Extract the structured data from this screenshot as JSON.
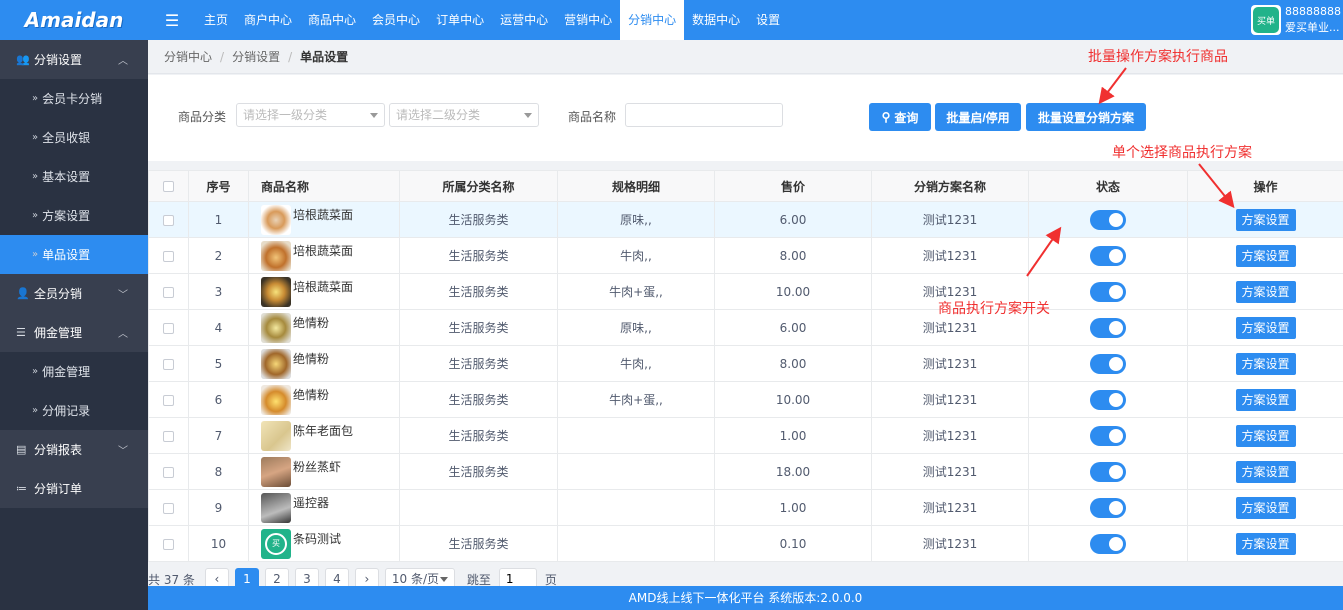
{
  "app": {
    "logo_text": "Amaidan",
    "menu_icon": "hamburger-icon"
  },
  "topnav": [
    {
      "label": "主页",
      "active": false
    },
    {
      "label": "商户中心",
      "active": false
    },
    {
      "label": "商品中心",
      "active": false
    },
    {
      "label": "会员中心",
      "active": false
    },
    {
      "label": "订单中心",
      "active": false
    },
    {
      "label": "运营中心",
      "active": false
    },
    {
      "label": "营销中心",
      "active": false
    },
    {
      "label": "分销中心",
      "active": true
    },
    {
      "label": "数据中心",
      "active": false
    },
    {
      "label": "设置",
      "active": false
    }
  ],
  "user": {
    "avatar_text": "买单",
    "id": "88888888",
    "name": "爱买单业..."
  },
  "sidebar": {
    "groups": [
      {
        "label": "分销设置",
        "icon": "users-icon",
        "expanded": true,
        "items": [
          "会员卡分销",
          "全员收银",
          "基本设置",
          "方案设置",
          "单品设置"
        ]
      },
      {
        "label": "全员分销",
        "icon": "user-icon",
        "expanded": false,
        "items": []
      },
      {
        "label": "佣金管理",
        "icon": "database-icon",
        "expanded": true,
        "items": [
          "佣金管理",
          "分佣记录"
        ]
      },
      {
        "label": "分销报表",
        "icon": "report-icon",
        "expanded": false,
        "items": []
      },
      {
        "label": "分销订单",
        "icon": "list-icon",
        "expanded": false,
        "items": []
      }
    ],
    "active_item": "单品设置"
  },
  "breadcrumb": [
    "分销中心",
    "分销设置",
    "单品设置"
  ],
  "filter": {
    "category_label": "商品分类",
    "category1_placeholder": "请选择一级分类",
    "category2_placeholder": "请选择二级分类",
    "name_label": "商品名称",
    "name_value": "",
    "query_button": "查询",
    "batch_toggle_button": "批量启/停用",
    "batch_plan_button": "批量设置分销方案"
  },
  "table": {
    "columns": [
      "序号",
      "商品名称",
      "所属分类名称",
      "规格明细",
      "售价",
      "分销方案名称",
      "状态",
      "操作"
    ],
    "rows": [
      {
        "no": "1",
        "name": "培根蔬菜面",
        "category": "生活服务类",
        "spec": "原味,,",
        "price": "6.00",
        "plan": "测试1231",
        "enabled": true,
        "action": "方案设置"
      },
      {
        "no": "2",
        "name": "培根蔬菜面",
        "category": "生活服务类",
        "spec": "牛肉,,",
        "price": "8.00",
        "plan": "测试1231",
        "enabled": true,
        "action": "方案设置"
      },
      {
        "no": "3",
        "name": "培根蔬菜面",
        "category": "生活服务类",
        "spec": "牛肉+蛋,,",
        "price": "10.00",
        "plan": "测试1231",
        "enabled": true,
        "action": "方案设置"
      },
      {
        "no": "4",
        "name": "绝情粉",
        "category": "生活服务类",
        "spec": "原味,,",
        "price": "6.00",
        "plan": "测试1231",
        "enabled": true,
        "action": "方案设置"
      },
      {
        "no": "5",
        "name": "绝情粉",
        "category": "生活服务类",
        "spec": "牛肉,,",
        "price": "8.00",
        "plan": "测试1231",
        "enabled": true,
        "action": "方案设置"
      },
      {
        "no": "6",
        "name": "绝情粉",
        "category": "生活服务类",
        "spec": "牛肉+蛋,,",
        "price": "10.00",
        "plan": "测试1231",
        "enabled": true,
        "action": "方案设置"
      },
      {
        "no": "7",
        "name": "陈年老面包",
        "category": "生活服务类",
        "spec": "",
        "price": "1.00",
        "plan": "测试1231",
        "enabled": true,
        "action": "方案设置"
      },
      {
        "no": "8",
        "name": "粉丝蒸虾",
        "category": "生活服务类",
        "spec": "",
        "price": "18.00",
        "plan": "测试1231",
        "enabled": true,
        "action": "方案设置"
      },
      {
        "no": "9",
        "name": "遥控器",
        "category": "",
        "spec": "",
        "price": "1.00",
        "plan": "测试1231",
        "enabled": true,
        "action": "方案设置"
      },
      {
        "no": "10",
        "name": "条码测试",
        "category": "生活服务类",
        "spec": "",
        "price": "0.10",
        "plan": "测试1231",
        "enabled": true,
        "action": "方案设置"
      }
    ]
  },
  "pagination": {
    "total_text": "共 37 条",
    "prev": "‹",
    "pages": [
      "1",
      "2",
      "3",
      "4"
    ],
    "current": "1",
    "next": "›",
    "page_size": "10 条/页",
    "jump_label": "跳至",
    "jump_value": "1",
    "page_unit": "页"
  },
  "footer": {
    "text": "AMD线上线下一体化平台 系统版本:2.0.0.0"
  },
  "annotations": {
    "batch_note": "批量操作方案执行商品",
    "single_note": "单个选择商品执行方案",
    "toggle_note": "商品执行方案开关",
    "color": "#f03030"
  },
  "colors": {
    "primary": "#2d8cf0",
    "sidebar": "#2a3242",
    "sidebar_group": "#383f4f"
  }
}
